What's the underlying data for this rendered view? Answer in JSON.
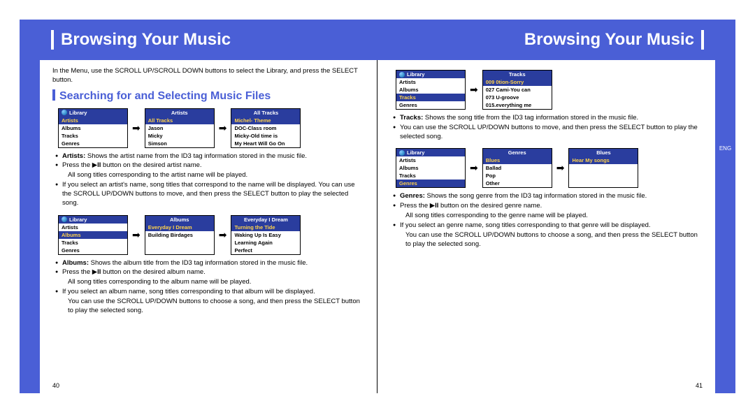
{
  "header": {
    "title_left": "Browsing Your Music",
    "title_right": "Browsing Your Music"
  },
  "lang_tab": "ENG",
  "page_left": "40",
  "page_right": "41",
  "intro": "In the Menu, use the SCROLL UP/SCROLL DOWN buttons to select the Library, and  press the SELECT button.",
  "section_heading": "Searching for and Selecting Music Files",
  "artists_row": {
    "lib": {
      "title": "Library",
      "sel": "Artists",
      "items": [
        "Albums",
        "Tracks",
        "Genres"
      ]
    },
    "mid": {
      "title": "Artists",
      "sel": "All Tracks",
      "items": [
        "Jason",
        "Micky",
        "Simson"
      ]
    },
    "right": {
      "title": "All Tracks",
      "sel": "Michel- Theme",
      "items": [
        "DOC-Class room",
        "Micky-Old time is",
        "My Heart Will Go On"
      ]
    }
  },
  "artists_bullets": [
    "<b>Artists:</b> Shows the artist name from the ID3 tag information stored in the music file.",
    "Press the ▶<b>II</b> button on the desired artist name.",
    "All song titles corresponding to the artist name will be played.",
    "If you select an artist's name, song titles that correspond to the name will be displayed. You can use the SCROLL UP/DOWN buttons to move, and then press the SELECT button to play the selected song."
  ],
  "albums_row": {
    "lib": {
      "title": "Library",
      "sel": "Albums",
      "pre": [
        "Artists"
      ],
      "items": [
        "Tracks",
        "Genres"
      ]
    },
    "mid": {
      "title": "Albums",
      "sel": "Everyday I Dream",
      "items": [
        "Building Birdages"
      ]
    },
    "right": {
      "title": "Everyday I Dream",
      "sel": "Turning the Tide",
      "items": [
        "Waking Up Is Easy",
        "Learning Again",
        "Perfect"
      ]
    }
  },
  "albums_bullets": [
    "<b>Albums:</b> Shows the album title from the ID3 tag information stored in the music file.",
    "Press the ▶<b>II</b> button on the desired album name.",
    "All song titles corresponding to the album name will be played.",
    "If you select an album name, song titles corresponding to that album will be displayed.",
    "You can use the SCROLL UP/DOWN buttons to choose a song, and then press the SELECT button to play the selected song."
  ],
  "tracks_row": {
    "lib": {
      "title": "Library",
      "sel": "Tracks",
      "pre": [
        "Artists",
        "Albums"
      ],
      "items": [
        "Genres"
      ]
    },
    "right": {
      "title": "Tracks",
      "sel": "009 0tion-Sorry",
      "items": [
        "027 Cami-You can",
        "073 U-groove",
        "015.everything me"
      ]
    }
  },
  "tracks_bullets": [
    "<b>Tracks:</b> Shows the song title from the ID3 tag information stored in the music file.",
    "You can use the SCROLL UP/DOWN buttons to move, and then press the SELECT button to play the selected song."
  ],
  "genres_row": {
    "lib": {
      "title": "Library",
      "sel": "Genres",
      "pre": [
        "Artists",
        "Albums",
        "Tracks"
      ],
      "items": []
    },
    "mid": {
      "title": "Genres",
      "sel": "Blues",
      "items": [
        "Ballad",
        "Pop",
        "Other"
      ]
    },
    "right": {
      "title": "Blues",
      "sel": "Hear My songs",
      "items": []
    }
  },
  "genres_bullets": [
    "<b>Genres:</b> Shows the song genre from the ID3 tag information stored in the music file.",
    "Press the ▶<b>II</b> button on the desired genre name.",
    "All song titles corresponding to the genre name will be played.",
    "If you select an genre name, song titles corresponding to that genre will be displayed.",
    "You can use the SCROLL UP/DOWN buttons to choose a song, and then press the SELECT button to play the selected song."
  ]
}
